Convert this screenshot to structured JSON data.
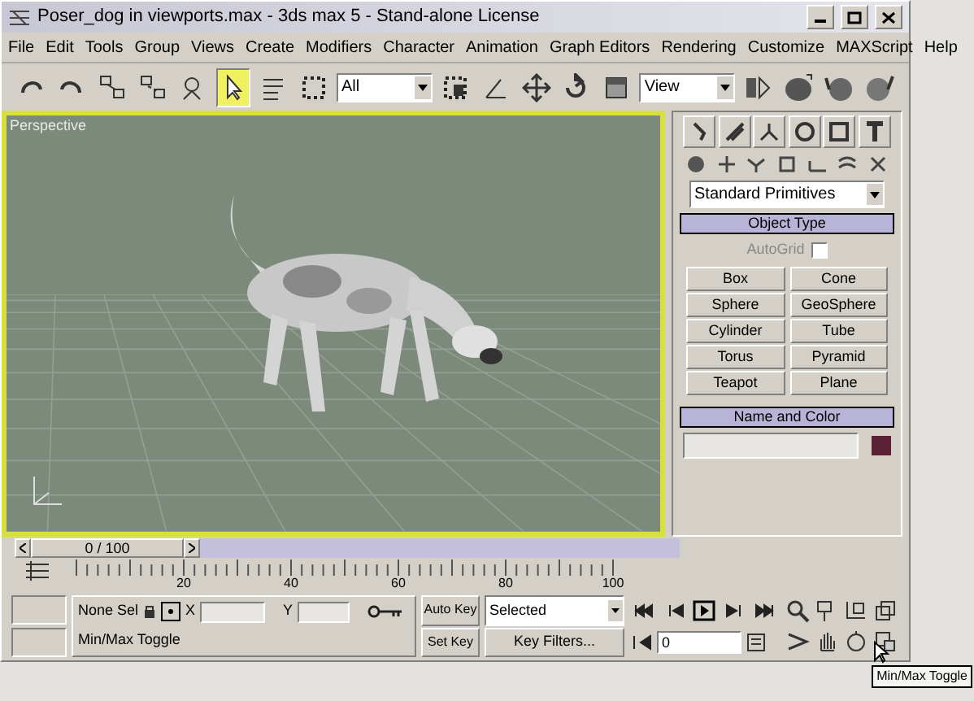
{
  "window": {
    "title": "Poser_dog in viewports.max - 3ds max 5 - Stand-alone License"
  },
  "menu": [
    "File",
    "Edit",
    "Tools",
    "Group",
    "Views",
    "Create",
    "Modifiers",
    "Character",
    "Animation",
    "Graph Editors",
    "Rendering",
    "Customize",
    "MAXScript",
    "Help"
  ],
  "toolbar": [
    {
      "kind": "icon",
      "selected": false
    },
    {
      "kind": "icon",
      "selected": false
    },
    {
      "kind": "icon",
      "selected": false
    },
    {
      "kind": "icon",
      "selected": false
    },
    {
      "kind": "icon",
      "selected": false
    },
    {
      "kind": "icon",
      "selected": true
    },
    {
      "kind": "icon",
      "selected": false
    },
    {
      "kind": "icon",
      "selected": false
    },
    {
      "kind": "dropdown",
      "value": "All"
    },
    {
      "kind": "icon",
      "selected": false
    },
    {
      "kind": "icon",
      "selected": false
    },
    {
      "kind": "icon",
      "selected": false
    },
    {
      "kind": "icon",
      "selected": false
    },
    {
      "kind": "icon",
      "selected": false
    },
    {
      "kind": "dropdown",
      "value": "View"
    },
    {
      "kind": "icon",
      "selected": false
    },
    {
      "kind": "icon",
      "selected": false
    },
    {
      "kind": "icon",
      "selected": false
    },
    {
      "kind": "icon",
      "selected": false
    }
  ],
  "viewport": {
    "label": "Perspective"
  },
  "command_panel": {
    "category": "Standard Primitives",
    "object_type": {
      "title": "Object Type",
      "autogrid": {
        "label": "AutoGrid",
        "checked": false
      },
      "buttons": [
        "Box",
        "Cone",
        "Sphere",
        "GeoSphere",
        "Cylinder",
        "Tube",
        "Torus",
        "Pyramid",
        "Teapot",
        "Plane"
      ]
    },
    "name_and_color": {
      "title": "Name and Color",
      "color": "#5a2234"
    }
  },
  "time_slider": {
    "label": "0 / 100"
  },
  "track_bar": {
    "labels": [
      "20",
      "40",
      "60",
      "80",
      "100"
    ]
  },
  "status": {
    "selection": "None Sel",
    "x_label": "X",
    "y_label": "Y",
    "prompt": "Min/Max Toggle",
    "auto_key": "Auto Key",
    "set_key": "Set Key",
    "key_mode": "Selected",
    "key_filters": "Key Filters...",
    "frame": "0"
  },
  "tooltip": "Min/Max Toggle"
}
